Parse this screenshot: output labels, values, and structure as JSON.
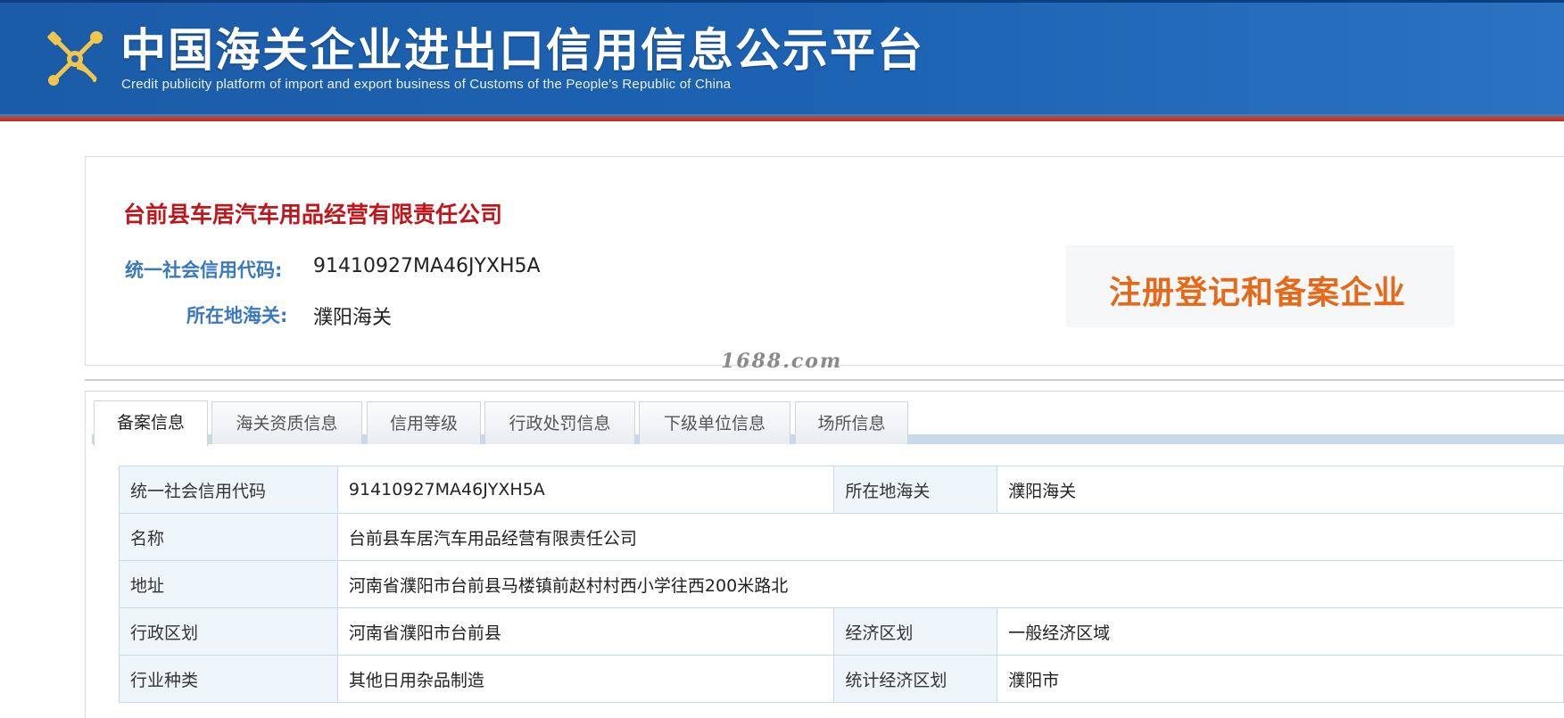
{
  "header": {
    "title": "中国海关企业进出口信用信息公示平台",
    "subtitle": "Credit publicity platform of import and export business of Customs of the People's Republic of China"
  },
  "company": {
    "name": "台前县车居汽车用品经营有限责任公司",
    "credit_code_label": "统一社会信用代码:",
    "credit_code": "91410927MA46JYXH5A",
    "customs_label": "所在地海关:",
    "customs": "濮阳海关",
    "registration_status": "注册登记和备案企业"
  },
  "watermark": "1688.com",
  "tabs": [
    {
      "label": "备案信息",
      "active": true
    },
    {
      "label": "海关资质信息",
      "active": false
    },
    {
      "label": "信用等级",
      "active": false
    },
    {
      "label": "行政处罚信息",
      "active": false
    },
    {
      "label": "下级单位信息",
      "active": false
    },
    {
      "label": "场所信息",
      "active": false
    }
  ],
  "details": {
    "credit_code_label": "统一社会信用代码",
    "credit_code": "91410927MA46JYXH5A",
    "customs_label": "所在地海关",
    "customs": "濮阳海关",
    "name_label": "名称",
    "name": "台前县车居汽车用品经营有限责任公司",
    "address_label": "地址",
    "address": "河南省濮阳市台前县马楼镇前赵村村西小学往西200米路北",
    "admin_region_label": "行政区划",
    "admin_region": "河南省濮阳市台前县",
    "economic_region_label": "经济区划",
    "economic_region": "一般经济区域",
    "industry_label": "行业种类",
    "industry": "其他日用杂品制造",
    "stat_region_label": "统计经济区划",
    "stat_region": "濮阳市"
  },
  "colors": {
    "header_blue": "#1d63b3",
    "accent_red": "#c0161b",
    "label_blue": "#3a78bf",
    "stamp_orange": "#e46a1a"
  }
}
